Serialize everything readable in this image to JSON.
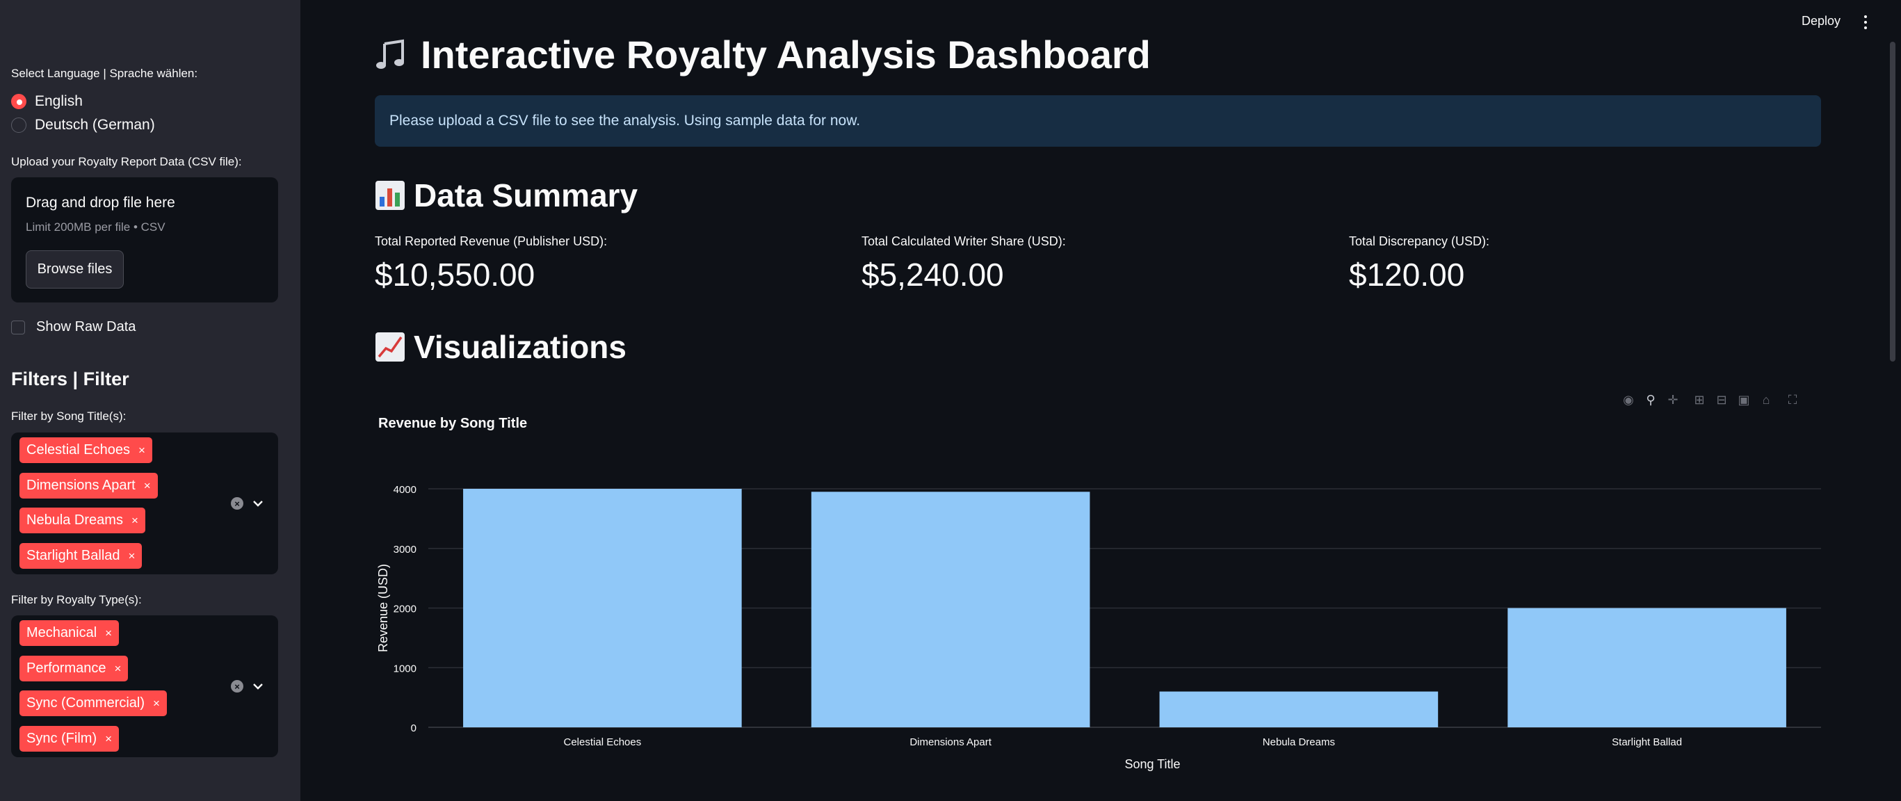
{
  "header": {
    "deploy_label": "Deploy"
  },
  "sidebar": {
    "language_label": "Select Language | Sprache wählen:",
    "languages": [
      "English",
      "Deutsch (German)"
    ],
    "language_selected": "English",
    "upload_label": "Upload your Royalty Report Data (CSV file):",
    "dropzone_title": "Drag and drop file here",
    "dropzone_limit": "Limit 200MB per file • CSV",
    "browse_label": "Browse files",
    "raw_data_label": "Show Raw Data",
    "filters_heading": "Filters | Filter",
    "song_filter_label": "Filter by Song Title(s):",
    "song_tags": [
      "Celestial Echoes",
      "Dimensions Apart",
      "Nebula Dreams",
      "Starlight Ballad"
    ],
    "type_filter_label": "Filter by Royalty Type(s):",
    "type_tags": [
      "Mechanical",
      "Performance",
      "Sync (Commercial)",
      "Sync (Film)"
    ],
    "tag_remove": "×"
  },
  "main": {
    "title": "Interactive Royalty Analysis Dashboard",
    "info_message": "Please upload a CSV file to see the analysis. Using sample data for now.",
    "summary_heading": "Data Summary",
    "metrics": [
      {
        "label": "Total Reported Revenue (Publisher USD):",
        "value": "$10,550.00"
      },
      {
        "label": "Total Calculated Writer Share (USD):",
        "value": "$5,240.00"
      },
      {
        "label": "Total Discrepancy (USD):",
        "value": "$120.00"
      }
    ],
    "viz_heading": "Visualizations"
  },
  "colors": {
    "accent": "#ff4b4b",
    "bar": "#90c8f8",
    "info_bg": "#172d43"
  },
  "chart_data": {
    "type": "bar",
    "title": "Revenue by Song Title",
    "categories": [
      "Celestial Echoes",
      "Dimensions Apart",
      "Nebula Dreams",
      "Starlight Ballad"
    ],
    "values": [
      4000,
      3950,
      600,
      2000
    ],
    "xlabel": "Song Title",
    "ylabel": "Revenue (USD)",
    "ylim": [
      0,
      4000
    ],
    "yticks": [
      0,
      1000,
      2000,
      3000,
      4000
    ],
    "grid": true
  }
}
